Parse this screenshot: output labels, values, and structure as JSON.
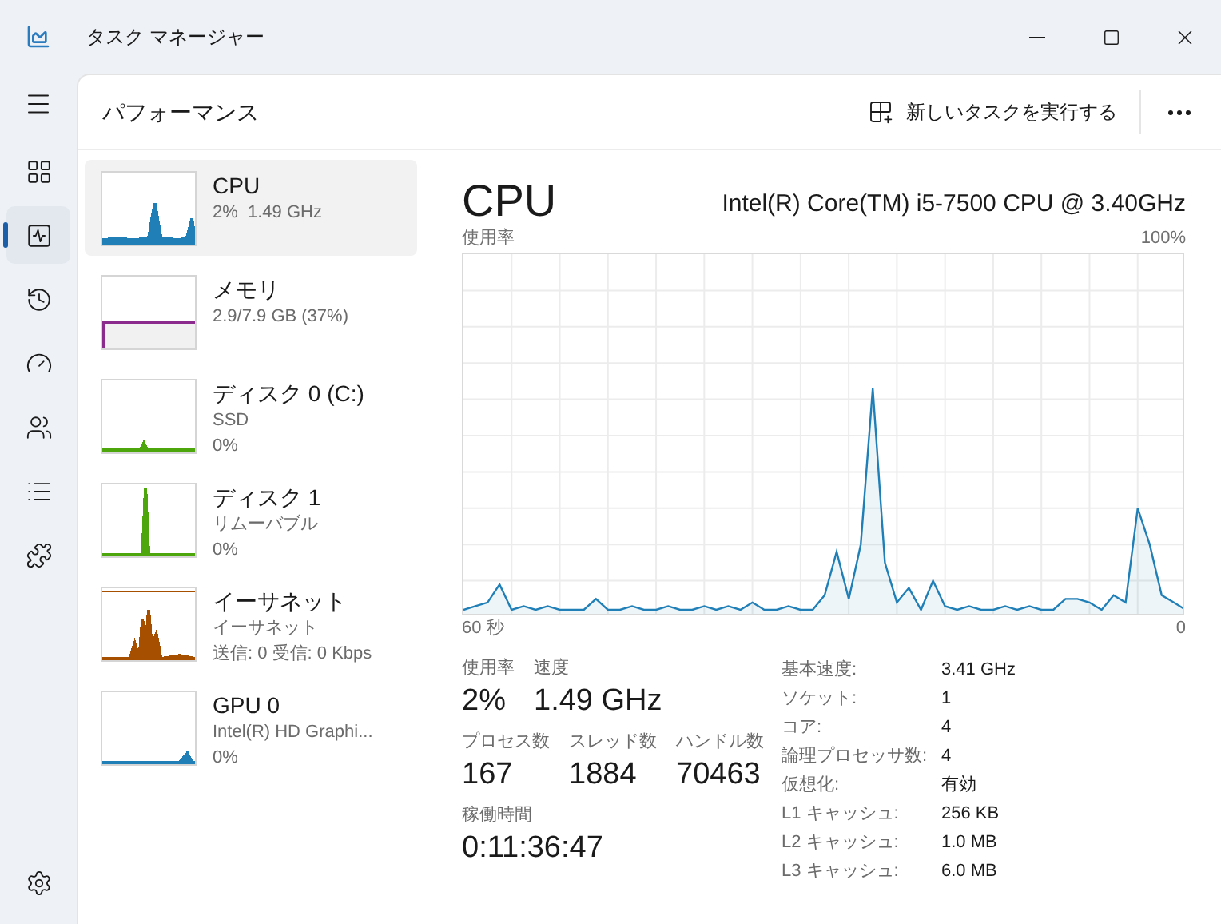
{
  "window": {
    "title": "タスク マネージャー"
  },
  "nav": [
    {
      "kind": "processes",
      "selected": false
    },
    {
      "kind": "performance",
      "selected": true
    },
    {
      "kind": "history",
      "selected": false
    },
    {
      "kind": "startup",
      "selected": false
    },
    {
      "kind": "users",
      "selected": false
    },
    {
      "kind": "details",
      "selected": false
    },
    {
      "kind": "services",
      "selected": false
    }
  ],
  "header": {
    "title": "パフォーマンス",
    "run_task": "新しいタスクを実行する"
  },
  "devices": [
    {
      "kind": "cpu",
      "name": "CPU",
      "lines": [
        "2%  1.49 GHz"
      ],
      "selected": true,
      "color": "#1f7fb6"
    },
    {
      "kind": "memory",
      "name": "メモリ",
      "lines": [
        "2.9/7.9 GB (37%)"
      ],
      "selected": false,
      "color": "#8b2b8e"
    },
    {
      "kind": "disk",
      "name": "ディスク 0 (C:)",
      "lines": [
        "SSD",
        "0%"
      ],
      "selected": false,
      "color": "#4da60c"
    },
    {
      "kind": "disk_spike",
      "name": "ディスク 1",
      "lines": [
        "リムーバブル",
        "0%"
      ],
      "selected": false,
      "color": "#4da60c"
    },
    {
      "kind": "network",
      "name": "イーサネット",
      "lines": [
        "イーサネット",
        "送信: 0 受信: 0 Kbps"
      ],
      "selected": false,
      "color": "#a74f01"
    },
    {
      "kind": "gpu",
      "name": "GPU 0",
      "lines": [
        "Intel(R) HD Graphi...",
        "0%"
      ],
      "selected": false,
      "color": "#1f7fb6"
    }
  ],
  "detail": {
    "title": "CPU",
    "model": "Intel(R) Core(TM) i5-7500 CPU @ 3.40GHz",
    "graph": {
      "label": "使用率",
      "max_label": "100%",
      "start_label": "60 秒",
      "end_label": "0"
    },
    "stat_rows": [
      [
        {
          "label": "使用率",
          "value": "2%"
        },
        {
          "label": "速度",
          "value": "1.49 GHz"
        }
      ],
      [
        {
          "label": "プロセス数",
          "value": "167"
        },
        {
          "label": "スレッド数",
          "value": "1884"
        },
        {
          "label": "ハンドル数",
          "value": "70463"
        }
      ],
      [
        {
          "label": "稼働時間",
          "value": "0:11:36:47"
        }
      ]
    ],
    "specs": [
      {
        "label": "基本速度:",
        "value": "3.41 GHz"
      },
      {
        "label": "ソケット:",
        "value": "1"
      },
      {
        "label": "コア:",
        "value": "4"
      },
      {
        "label": "論理プロセッサ数:",
        "value": "4"
      },
      {
        "label": "仮想化:",
        "value": "有効"
      },
      {
        "label": "L1 キャッシュ:",
        "value": "256 KB"
      },
      {
        "label": "L2 キャッシュ:",
        "value": "1.0 MB"
      },
      {
        "label": "L3 キャッシュ:",
        "value": "6.0 MB"
      }
    ]
  }
}
